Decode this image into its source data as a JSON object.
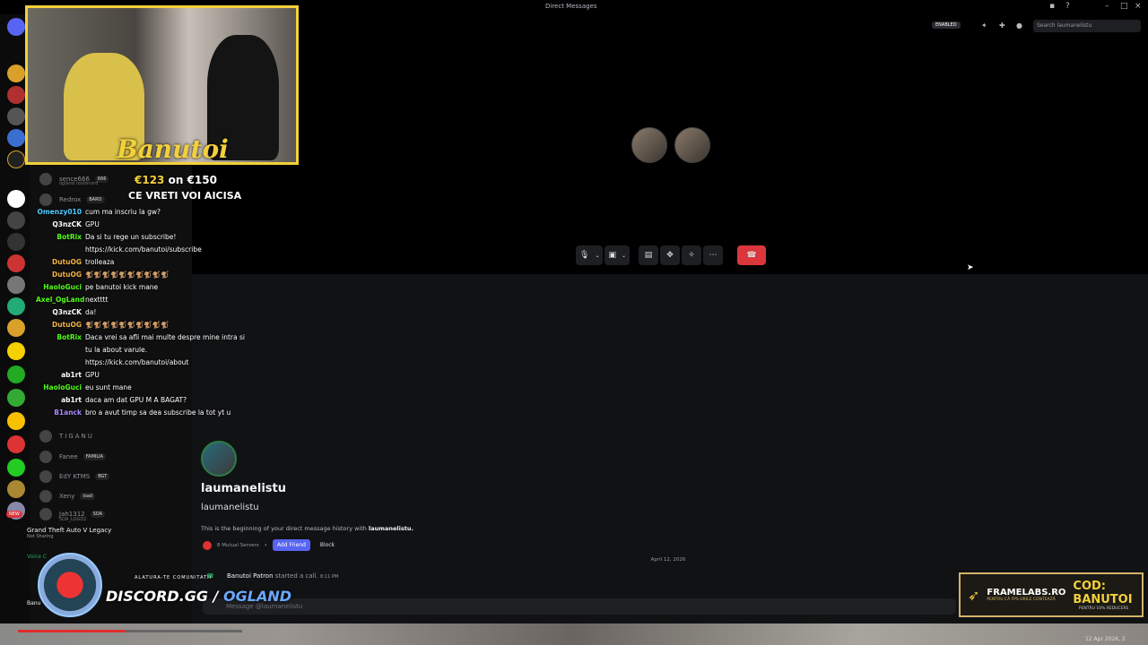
{
  "titlebar": {
    "title": "Direct Messages"
  },
  "topbar": {
    "enabled_badge": "ENABLED",
    "search_placeholder": "Search laumanelistu"
  },
  "stream": {
    "overlay_title": "Banutoi",
    "goal_current": "€123",
    "goal_on": "on",
    "goal_target": "€150",
    "goal_text": "CE VRETI VOI AICISA",
    "chat": [
      {
        "user": "Omenzy010",
        "msg": "cum ma inscriu la gw?",
        "color": "#4ecbff"
      },
      {
        "user": "Q3nzCK",
        "msg": "GPU",
        "color": "#ffffff"
      },
      {
        "user": "BotRix",
        "msg": "Da si tu rege un subscribe!",
        "color": "#53fc18"
      },
      {
        "user": "",
        "msg": "https://kick.com/banutoi/subscribe",
        "color": "#ffffff"
      },
      {
        "user": "DutuOG",
        "msg": "trolleaza",
        "color": "#f5b342"
      },
      {
        "user": "DutuOG",
        "msg": "🐒🐒🐒🐒🐒🐒🐒🐒🐒🐒",
        "color": "#f5b342"
      },
      {
        "user": "HaoloGuci",
        "msg": "pe banutoi kick mane",
        "color": "#53fc18"
      },
      {
        "user": "Axel_OgLand",
        "msg": "nextttt",
        "color": "#53fc18"
      },
      {
        "user": "Q3nzCK",
        "msg": "da!",
        "color": "#ffffff"
      },
      {
        "user": "DutuOG",
        "msg": "🐒🐒🐒🐒🐒🐒🐒🐒🐒🐒",
        "color": "#f5b342"
      },
      {
        "user": "BotRix",
        "msg": "Daca vrei sa afli mai multe despre mine intra si",
        "color": "#53fc18"
      },
      {
        "user": "",
        "msg": "tu la about varule.",
        "color": "#ffffff"
      },
      {
        "user": "",
        "msg": "https://kick.com/banutoi/about",
        "color": "#ffffff"
      },
      {
        "user": "ab1rt",
        "msg": "GPU",
        "color": "#ffffff"
      },
      {
        "user": "HaoloGuci",
        "msg": "eu sunt mane",
        "color": "#53fc18"
      },
      {
        "user": "ab1rt",
        "msg": "daca am dat GPU M A BAGAT?",
        "color": "#ffffff"
      },
      {
        "user": "B1anck",
        "msg": "bro a avut timp sa dea subscribe la tot yt u",
        "color": "#a98aff"
      }
    ],
    "discord_prefix": "DISCORD.GG / ",
    "discord_suffix": "OGLAND",
    "join_text": "ALATURA-TE COMUNITATII"
  },
  "sidebar": {
    "members_top": [
      {
        "name": "sence666",
        "tag": "666",
        "sub": "ogland.ro/discord"
      },
      {
        "name": "Redrox",
        "tag": "BARO"
      }
    ],
    "category": "TIGANU",
    "members": [
      {
        "name": "Fanee",
        "tag": "FAMILIA"
      },
      {
        "name": "EdY KTMS",
        "tag": "BGT"
      },
      {
        "name": "Xeny",
        "tag": "load"
      },
      {
        "name": "Jah1312",
        "tag": "SOA",
        "sub": "SOA_LOGO2"
      }
    ],
    "new_badge": "NEW",
    "game": {
      "title": "Grand Theft Auto V Legacy",
      "sub": "Not Sharing"
    },
    "voice_label": "Voice C",
    "user_name": "Banu"
  },
  "dm": {
    "display_name": "laumanelistu",
    "username": "laumanelistu",
    "begin_prefix": "This is the beginning of your direct message history with ",
    "begin_name": "laumanelistu.",
    "mutual": "8 Mutual Servers",
    "add_friend": "Add Friend",
    "block": "Block",
    "date_divider": "April 12, 2026",
    "call_user": "Banutoi Patron",
    "call_text": "started a call.",
    "call_time": "8:11 PM",
    "message_placeholder": "Message @laumanelistu"
  },
  "ad": {
    "brand": "FRAMELABS.RO",
    "brand_sub": "PENTRU CĂ FPS-URILE CONTEAZĂ",
    "code": "COD: BANUTOI",
    "code_sub": "PENTRU 10% REDUCERE"
  },
  "playback": {
    "progress_fraction": 0.48,
    "timestamp": "12 Apr 2026, 2"
  }
}
